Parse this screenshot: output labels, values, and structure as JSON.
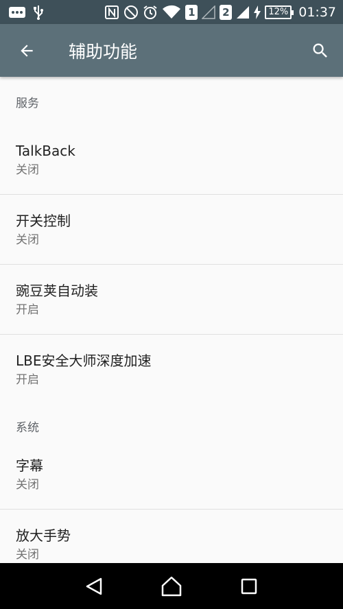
{
  "status_bar": {
    "sim1": "1",
    "sim2": "2",
    "battery": "12%",
    "time": "01:37",
    "icons": [
      "notification-icon",
      "usb-icon",
      "nfc-icon",
      "do-not-disturb-icon",
      "alarm-icon",
      "wifi-icon",
      "signal-icon",
      "charging-icon"
    ]
  },
  "app_bar": {
    "title": "辅助功能"
  },
  "sections": {
    "services": {
      "header": "服务",
      "items": [
        {
          "title": "TalkBack",
          "summary": "关闭"
        },
        {
          "title": "开关控制",
          "summary": "关闭"
        },
        {
          "title": "豌豆荚自动装",
          "summary": "开启"
        },
        {
          "title": "LBE安全大师深度加速",
          "summary": "开启"
        }
      ]
    },
    "system": {
      "header": "系统",
      "items": [
        {
          "title": "字幕",
          "summary": "关闭"
        },
        {
          "title": "放大手势",
          "summary": "关闭"
        }
      ]
    }
  },
  "colors": {
    "status_bar": "#3e5059",
    "app_bar": "#5c7079",
    "background": "#fafafa"
  }
}
